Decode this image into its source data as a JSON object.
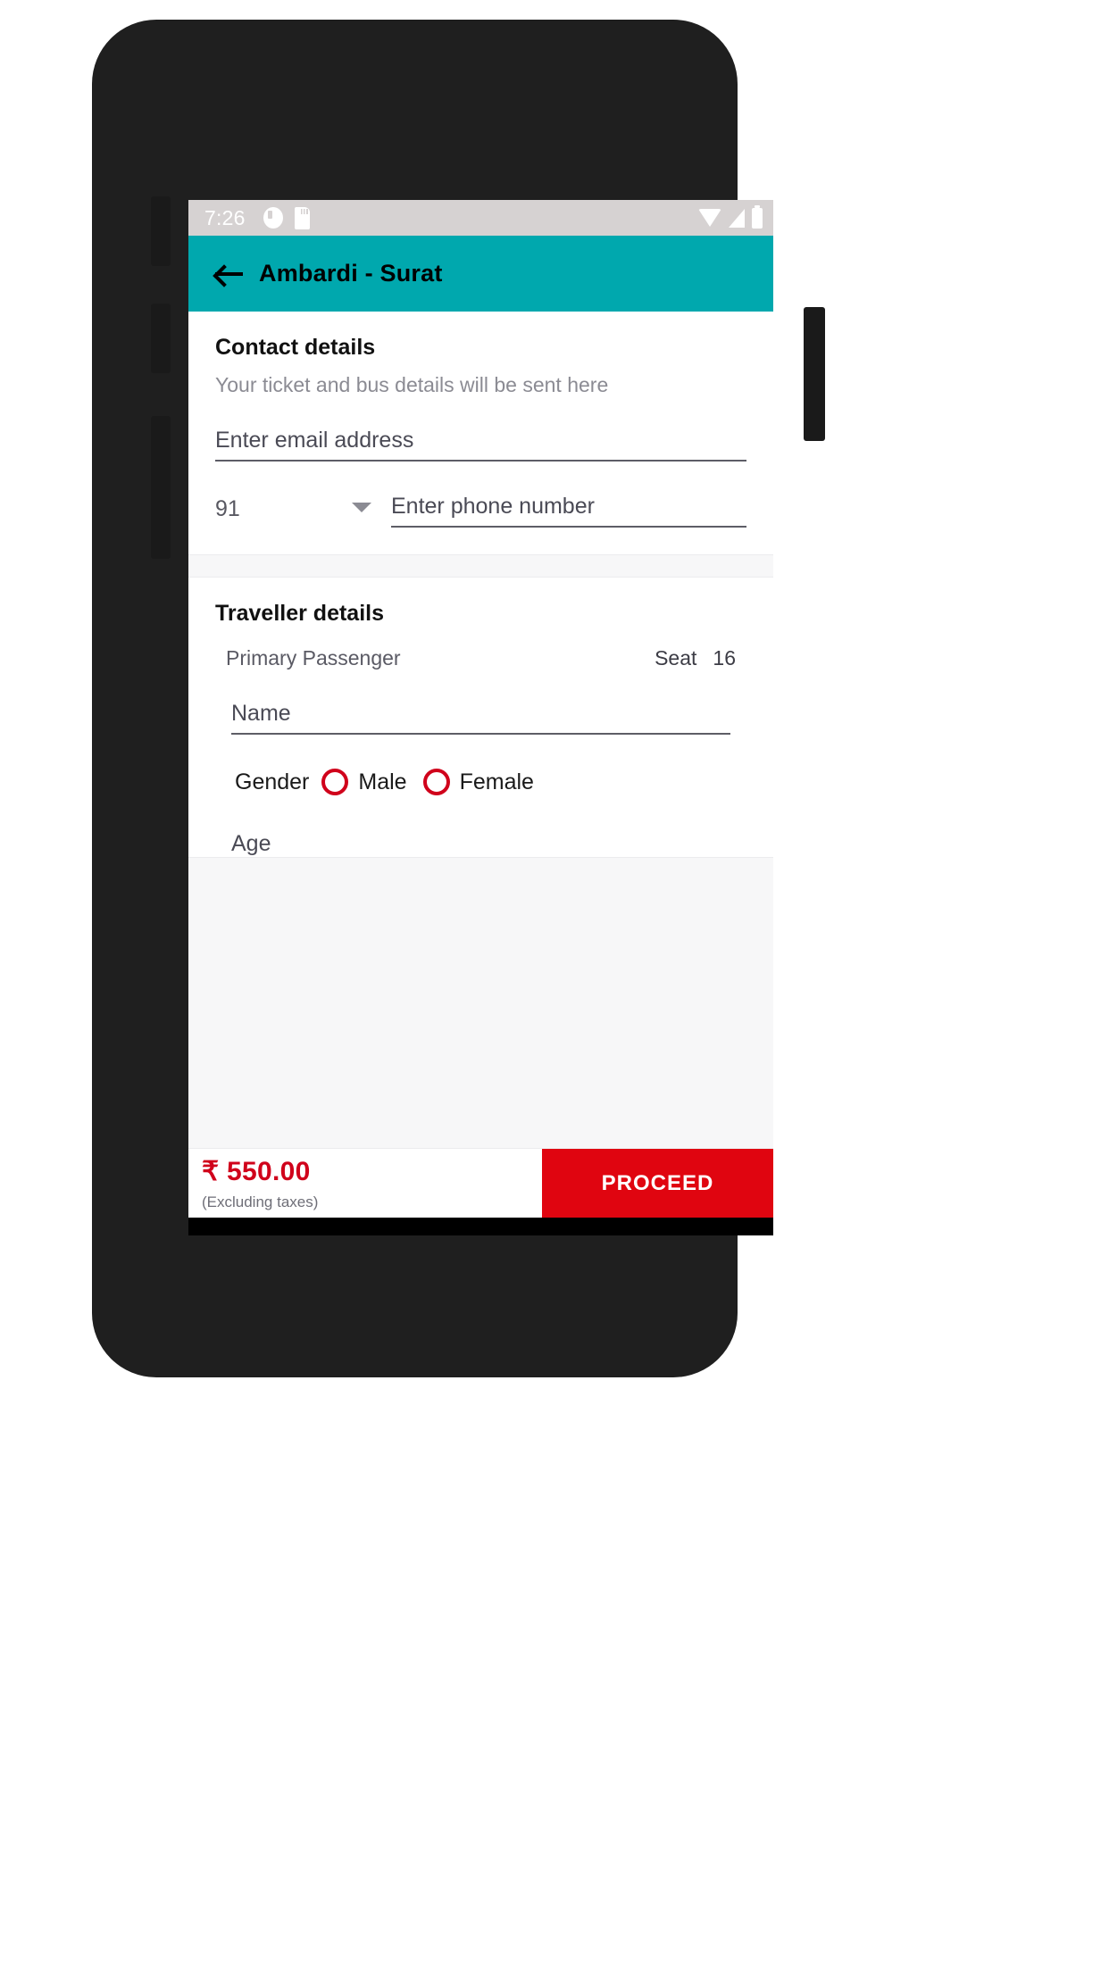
{
  "status_bar": {
    "time": "7:26",
    "left_icons": [
      "alarm-icon",
      "sd-card-icon"
    ],
    "right_icons": [
      "wifi-icon",
      "signal-icon",
      "battery-icon"
    ]
  },
  "app_bar": {
    "back_icon": "back-arrow-icon",
    "title": "Ambardi - Surat",
    "background_color": "#00a8ae"
  },
  "contact": {
    "title": "Contact details",
    "subtitle": "Your ticket and bus details will be sent here",
    "email_placeholder": "Enter email address",
    "email_value": "",
    "country_code": "91",
    "country_code_caret": "chevron-down-icon",
    "phone_placeholder": "Enter phone number",
    "phone_value": ""
  },
  "traveller": {
    "title": "Traveller details",
    "passenger_label": "Primary Passenger",
    "seat_label": "Seat",
    "seat_number": "16",
    "name_placeholder": "Name",
    "name_value": "",
    "gender_label": "Gender",
    "gender_options": [
      {
        "label": "Male",
        "selected": false
      },
      {
        "label": "Female",
        "selected": false
      }
    ],
    "age_placeholder": "Age",
    "age_value": "",
    "radio_color": "#d0021b"
  },
  "bottom_bar": {
    "price": "₹ 550.00",
    "price_note": "(Excluding taxes)",
    "proceed_label": "PROCEED",
    "price_color": "#d0021b",
    "button_color": "#e00510"
  },
  "nav_bar": {
    "back_icon": "nav-back-triangle-icon",
    "home_icon": "nav-home-circle-icon",
    "recents_icon": "nav-recents-square-icon"
  }
}
